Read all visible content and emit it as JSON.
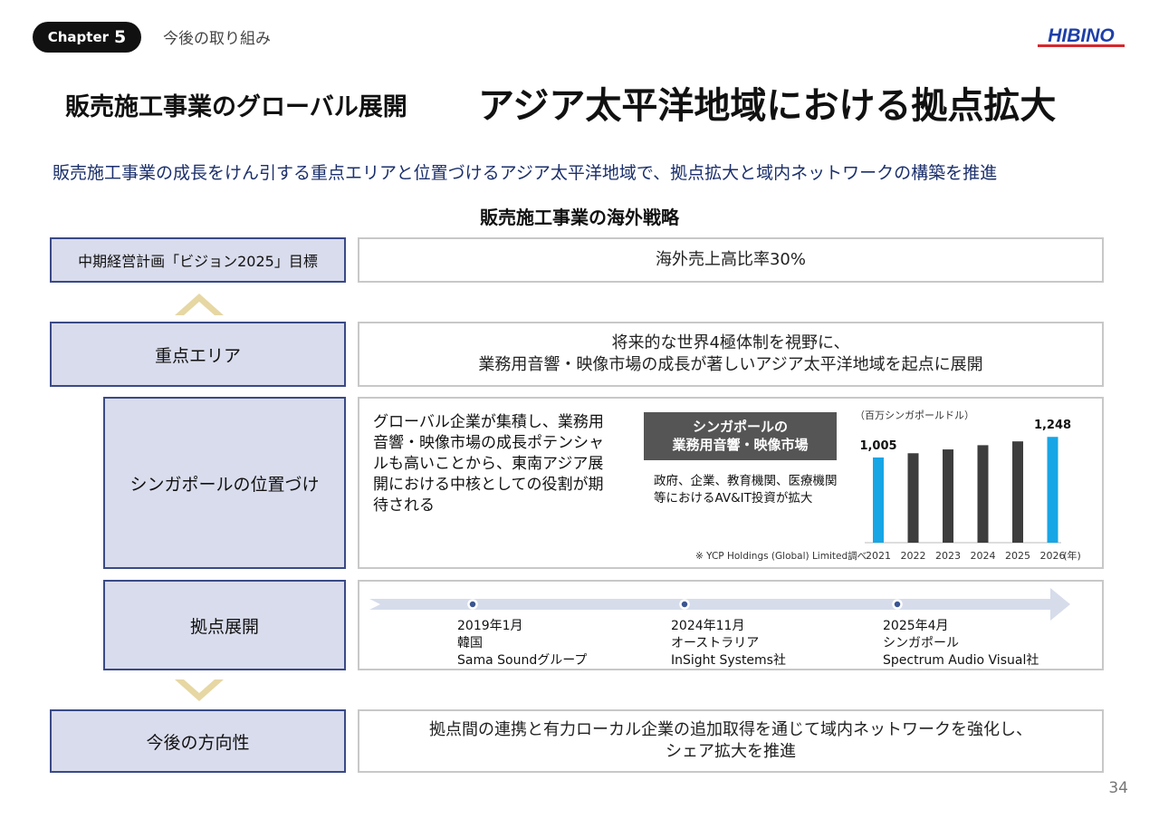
{
  "header": {
    "chapter_word": "Chapter",
    "chapter_num": "5",
    "chapter_subtitle": "今後の取り組み",
    "logo_text": "HIBINO"
  },
  "title": {
    "left": "販売施工事業のグローバル展開",
    "main": "アジア太平洋地域における拠点拡大"
  },
  "lead": "販売施工事業の成長をけん引する重点エリアと位置づけるアジア太平洋地域で、拠点拡大と域内ネットワークの構築を推進",
  "section_heading": "販売施工事業の海外戦略",
  "rows": {
    "goal": {
      "label": "中期経営計画「ビジョン2025」目標",
      "content": "海外売上高比率30%"
    },
    "focus": {
      "label": "重点エリア",
      "content_line1": "将来的な世界4極体制を視野に、",
      "content_line2": "業務用音響・映像市場の成長が著しいアジア太平洋地域を起点に展開"
    },
    "singapore": {
      "label": "シンガポールの位置づけ",
      "desc": "グローバル企業が集積し、業務用音響・映像市場の成長ポテンシャルも高いことから、東南アジア展開における中核としての役割が期待される",
      "badge_line1": "シンガポールの",
      "badge_line2": "業務用音響・映像市場",
      "note": "政府、企業、教育機関、医療機関等におけるAV&IT投資が拡大",
      "source": "※ YCP Holdings (Global) Limited調べ"
    },
    "bases": {
      "label": "拠点展開",
      "items": [
        {
          "date": "2019年1月",
          "country": "韓国",
          "company": "Sama Soundグループ"
        },
        {
          "date": "2024年11月",
          "country": "オーストラリア",
          "company": "InSight Systems社"
        },
        {
          "date": "2025年4月",
          "country": "シンガポール",
          "company": "Spectrum Audio Visual社"
        }
      ]
    },
    "direction": {
      "label": "今後の方向性",
      "content_line1": "拠点間の連携と有力ローカル企業の追加取得を通じて域内ネットワークを強化し、",
      "content_line2": "シェア拡大を推進"
    }
  },
  "chart_data": {
    "type": "bar",
    "unit_label": "（百万シンガポールドル）",
    "categories": [
      "2021",
      "2022",
      "2023",
      "2024",
      "2025",
      "2026"
    ],
    "x_unit": "(年)",
    "values": [
      1005,
      1055,
      1100,
      1150,
      1195,
      1248
    ],
    "data_labels": [
      {
        "index": 0,
        "text": "1,005"
      },
      {
        "index": 5,
        "text": "1,248"
      }
    ],
    "highlight_indices": [
      0,
      5
    ],
    "colors": {
      "highlight": "#16a6e6",
      "normal": "#3d3d3d"
    },
    "ylim": [
      0,
      1400
    ]
  },
  "page_number": "34",
  "colors": {
    "label_fill": "#d9dcec",
    "label_border": "#3a4a86",
    "chevron": "#e6d7a3",
    "timeline": "#d6dcea",
    "lead_text": "#1b2f6b"
  }
}
